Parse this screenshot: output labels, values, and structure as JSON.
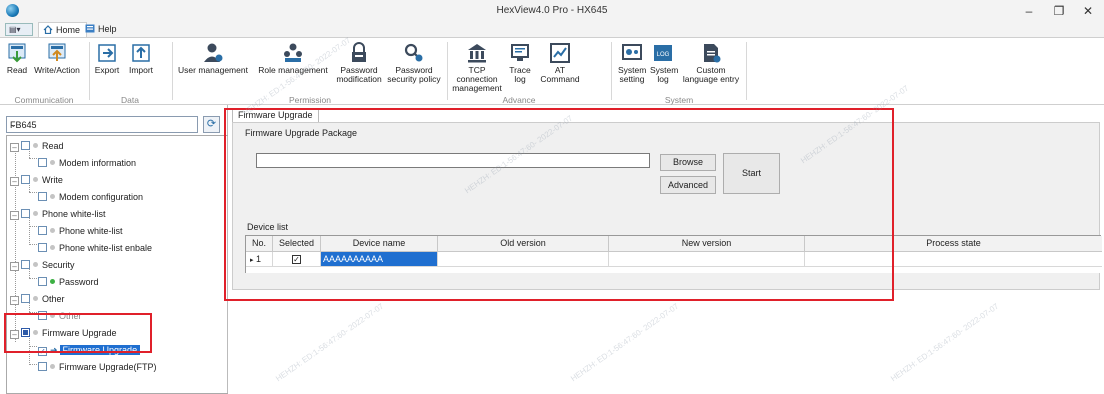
{
  "window": {
    "title": "HexView4.0 Pro - HX645",
    "minimize_glyph": "–",
    "maximize_glyph": "❐",
    "close_glyph": "✕"
  },
  "ribbon_tabs": [
    {
      "label": "Home",
      "icon": "home-icon"
    },
    {
      "label": "Help",
      "icon": "help-icon"
    }
  ],
  "ribbon_groups": [
    {
      "label": "Communication",
      "buttons": [
        {
          "label": "Read"
        },
        {
          "label": "Write/Action"
        }
      ]
    },
    {
      "label": "Data",
      "buttons": [
        {
          "label": "Export"
        },
        {
          "label": "Import"
        }
      ]
    },
    {
      "label": "Permission",
      "buttons": [
        {
          "label": "User management"
        },
        {
          "label": "Role management"
        },
        {
          "label": "Password modification"
        },
        {
          "label": "Password security policy"
        }
      ]
    },
    {
      "label": "Advance",
      "buttons": [
        {
          "label": "TCP connection management"
        },
        {
          "label": "Trace log"
        },
        {
          "label": "AT Command"
        }
      ]
    },
    {
      "label": "System",
      "buttons": [
        {
          "label": "System setting"
        },
        {
          "label": "System log"
        },
        {
          "label": "Custom language entry"
        }
      ]
    }
  ],
  "device_selector": {
    "value": "FB645"
  },
  "tree": [
    {
      "label": "Read"
    },
    {
      "label": "Modem information"
    },
    {
      "label": "Write"
    },
    {
      "label": "Modem configuration"
    },
    {
      "label": "Phone white-list"
    },
    {
      "label": "Phone white-list"
    },
    {
      "label": "Phone white-list enbale"
    },
    {
      "label": "Security"
    },
    {
      "label": "Password"
    },
    {
      "label": "Other"
    },
    {
      "label": "Other"
    },
    {
      "label": "Firmware Upgrade"
    },
    {
      "label": "Firmware Upgrade"
    },
    {
      "label": "Firmware Upgrade(FTP)"
    }
  ],
  "main": {
    "tab": "Firmware Upgrade",
    "package_label": "Firmware Upgrade Package",
    "package_path": "",
    "browse_label": "Browse",
    "advanced_label": "Advanced",
    "start_label": "Start",
    "device_list_label": "Device list",
    "columns": [
      "No.",
      "Selected",
      "Device name",
      "Old version",
      "New version",
      "Process state"
    ],
    "rows": [
      {
        "no": "1",
        "selected": true,
        "device_name": "AAAAAAAAAA",
        "old_version": "",
        "new_version": "",
        "process_state": ""
      }
    ]
  },
  "watermark": "HEHZH: ED:1-56:47:60- 2022-07-07",
  "colors": {
    "accent": "#1f6fd0",
    "highlight_box": "#e0202a"
  }
}
